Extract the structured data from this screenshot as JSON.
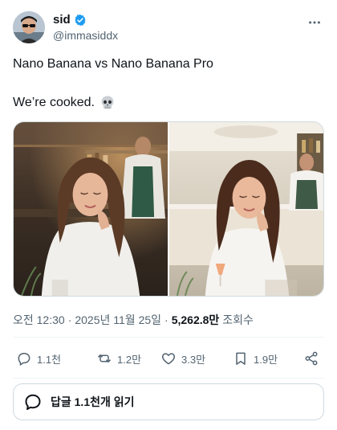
{
  "author": {
    "name": "sid",
    "handle": "@immasiddx"
  },
  "post": {
    "line1": "Nano Banana vs Nano Banana Pro",
    "line2": "We’re cooked.",
    "emoji": "skull-icon"
  },
  "meta": {
    "time": "오전 12:30",
    "sep1": "·",
    "date": "2025년 11월 25일",
    "sep2": "·",
    "views_count": "5,262.8만",
    "views_label": "조회수"
  },
  "actions": {
    "replies": "1.1천",
    "reposts": "1.2만",
    "likes": "3.3만",
    "bookmarks": "1.9만"
  },
  "reply_prompt": {
    "label": "답글 1.1천개 읽기"
  },
  "colors": {
    "verified": "#1d9bf0",
    "text": "#0f1419",
    "muted": "#536471",
    "border": "#cfd9de"
  }
}
